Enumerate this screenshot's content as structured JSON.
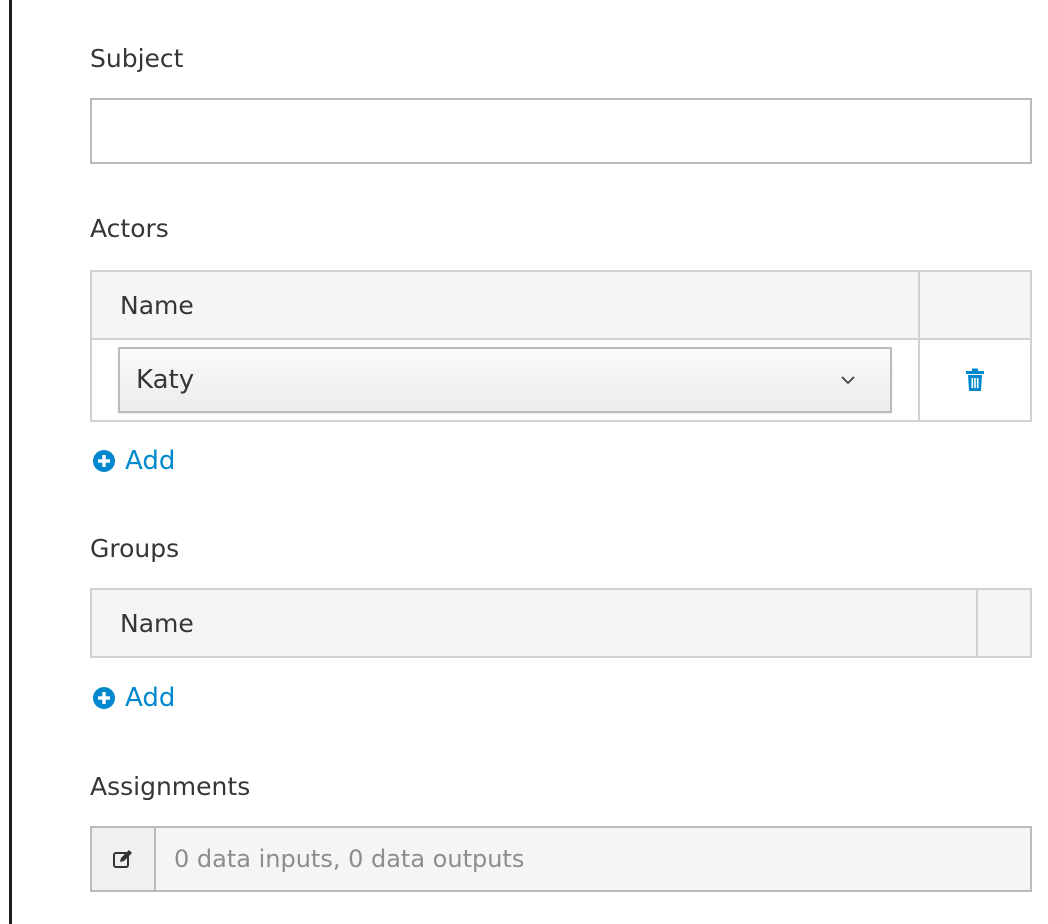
{
  "subject": {
    "label": "Subject",
    "value": "",
    "placeholder": ""
  },
  "actors": {
    "label": "Actors",
    "column_header": "Name",
    "rows": [
      {
        "value": "Katy"
      }
    ],
    "add_label": "Add"
  },
  "groups": {
    "label": "Groups",
    "column_header": "Name",
    "rows": [],
    "add_label": "Add"
  },
  "assignments": {
    "label": "Assignments",
    "value": "0 data inputs, 0 data outputs"
  },
  "icons": {
    "delete": "trash-icon",
    "add": "plus-circle-icon",
    "dropdown": "chevron-down-icon",
    "edit": "edit-icon"
  },
  "colors": {
    "accent": "#0088ce",
    "text": "#363636",
    "muted": "#8b8d8f",
    "border": "#bbbbbb",
    "header_bg": "#f5f5f5"
  }
}
